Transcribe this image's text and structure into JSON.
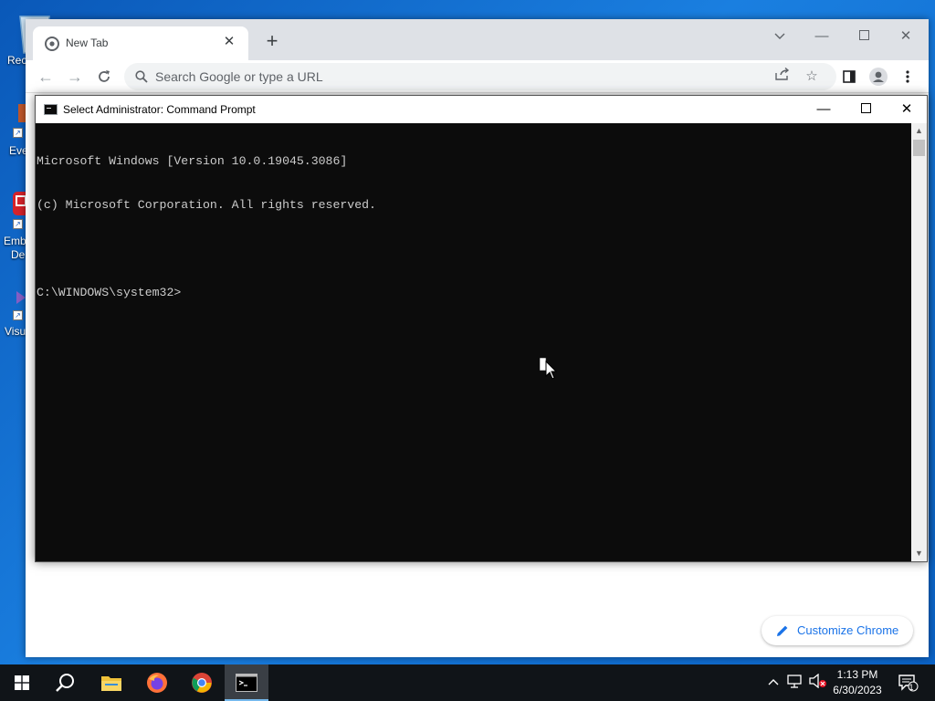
{
  "desktop": {
    "icons": [
      {
        "label": "Rec",
        "icon": "recycle-bin-icon"
      },
      {
        "label": "Eve",
        "icon": "event-viewer-shortcut-icon"
      },
      {
        "label": "Emb",
        "label2": "De",
        "icon": "embarcadero-shortcut-icon"
      },
      {
        "label": "Visu",
        "icon": "visual-studio-shortcut-icon"
      }
    ]
  },
  "chrome": {
    "tab": {
      "title": "New Tab"
    },
    "omnibox": {
      "placeholder": "Search Google or type a URL"
    },
    "customize_label": "Customize Chrome"
  },
  "cmd": {
    "title": "Select Administrator:  Command Prompt",
    "lines": [
      "Microsoft Windows [Version 10.0.19045.3086]",
      "(c) Microsoft Corporation. All rights reserved.",
      "",
      "C:\\WINDOWS\\system32>"
    ]
  },
  "taskbar": {
    "apps": [
      {
        "name": "start",
        "icon": "windows-logo-icon"
      },
      {
        "name": "search",
        "icon": "search-icon"
      },
      {
        "name": "file-explorer",
        "icon": "folder-icon"
      },
      {
        "name": "firefox",
        "icon": "firefox-icon"
      },
      {
        "name": "chrome",
        "icon": "chrome-icon"
      },
      {
        "name": "command-prompt",
        "icon": "cmd-icon",
        "active": true
      }
    ],
    "time": "1:13 PM",
    "date": "6/30/2023",
    "notification_count": "1"
  },
  "colors": {
    "desktop": "#1a7fe0",
    "console_bg": "#0c0c0c",
    "console_text": "#cccccc",
    "taskbar": "#101418",
    "chrome_accent": "#1a73e8"
  }
}
